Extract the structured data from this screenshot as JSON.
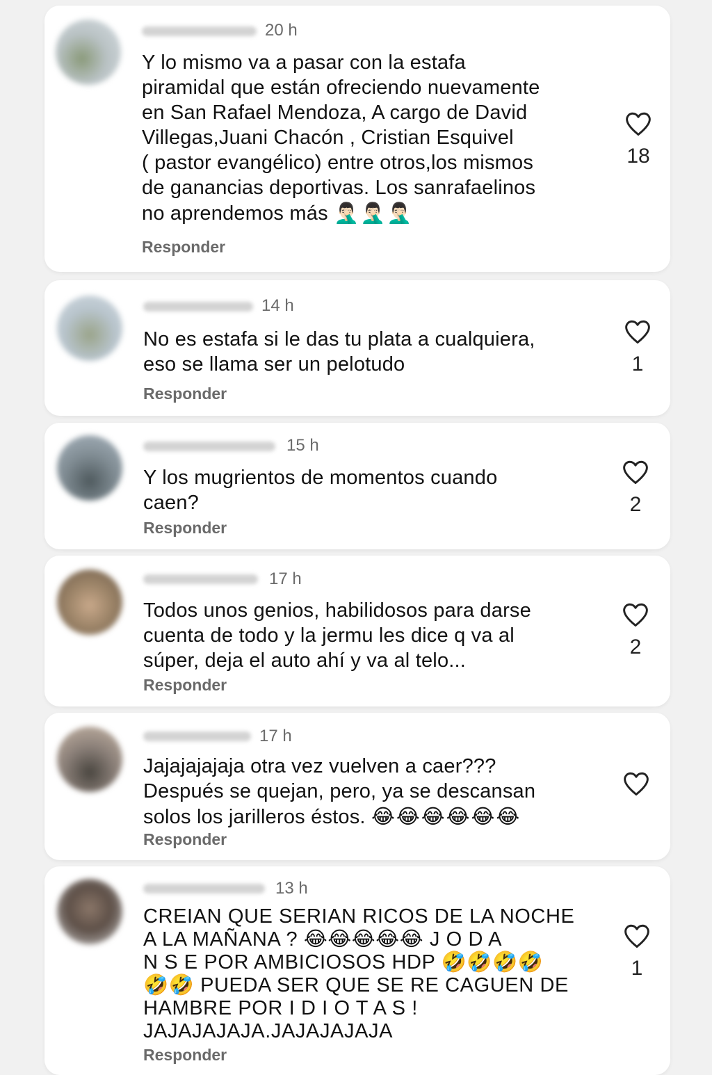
{
  "comments": [
    {
      "time": "20 h",
      "lines": [
        "Y lo mismo va a pasar con la estafa",
        "piramidal que están ofreciendo nuevamente",
        "en San Rafael Mendoza, A cargo de David",
        "Villegas,Juani Chacón , Cristian Esquivel",
        "( pastor evangélico) entre otros,los mismos",
        "de ganancias deportivas. Los sanrafaelinos",
        "no aprendemos más"
      ],
      "emoji_tail": "🤦🏻‍♂️🤦🏻‍♂️🤦🏻‍♂️",
      "reply": "Responder",
      "likes": "18"
    },
    {
      "time": "14 h",
      "lines": [
        "No es estafa si le das tu plata a cualquiera,",
        "eso se llama ser un pelotudo"
      ],
      "emoji_tail": "",
      "reply": "Responder",
      "likes": "1"
    },
    {
      "time": "15 h",
      "lines": [
        "Y los mugrientos de momentos cuando",
        "caen?"
      ],
      "emoji_tail": "",
      "reply": "Responder",
      "likes": "2"
    },
    {
      "time": "17 h",
      "lines": [
        "Todos unos genios, habilidosos para darse",
        "cuenta de todo y la jermu les dice q va al",
        "súper, deja el auto ahí y va al telo..."
      ],
      "emoji_tail": "",
      "reply": "Responder",
      "likes": "2"
    },
    {
      "time": "17 h",
      "lines": [
        "Jajajajajaja otra vez vuelven a caer???",
        "Después se quejan, pero, ya se descansan",
        "solos los jarilleros éstos."
      ],
      "emoji_tail": "😂😂😂😂😂😂",
      "reply": "Responder",
      "likes": ""
    },
    {
      "time": "13 h",
      "lines": [
        "CREIAN QUE SERIAN RICOS DE LA NOCHE",
        "A LA MAÑANA ?  😂😂😂😂😂  J O D A",
        "N  S  E  POR AMBICIOSOS HDP  🤣🤣🤣🤣",
        "🤣🤣  PUEDA SER QUE SE RE CAGUEN DE",
        "HAMBRE POR  I  D I O T A S  !",
        "JAJAJAJAJA.JAJAJAJAJA"
      ],
      "emoji_tail": "",
      "reply": "Responder",
      "likes": "1"
    }
  ],
  "colors": {
    "background": "#f1f1f1",
    "card": "#ffffff",
    "time_text": "#6b6b6b",
    "reply_text": "#6a6a6a",
    "heart_stroke": "#222222"
  },
  "icons": {
    "like": "heart-outline-icon"
  }
}
